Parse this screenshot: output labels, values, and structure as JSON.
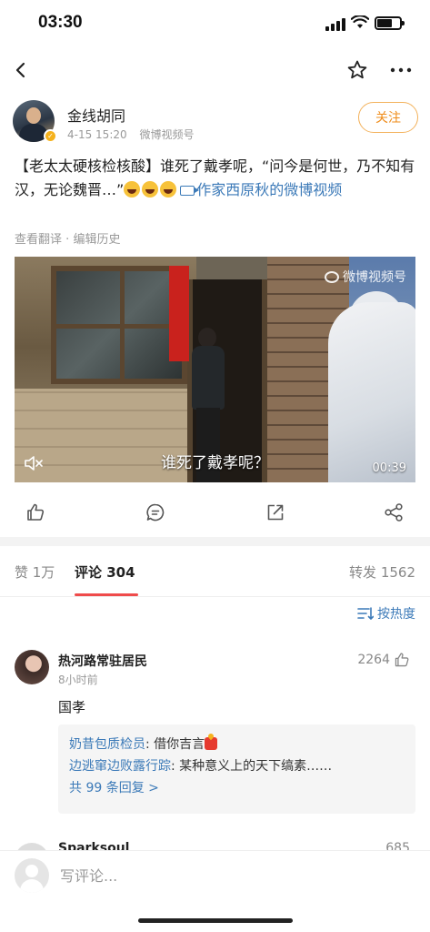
{
  "status_bar": {
    "time": "03:30"
  },
  "post": {
    "author": "金线胡同",
    "date": "4-15 15:20",
    "source": "微博视频号",
    "follow_label": "关注",
    "text_main": "【老太太硬核检核酸】谁死了戴孝呢，“问今是何世，乃不知有汉，无论魏晋…”",
    "text_link": "作家西原秋的微博视频",
    "translate_label": "查看翻译",
    "edit_history_label": "编辑历史",
    "separator": "·"
  },
  "video": {
    "watermark": "微博视频号",
    "subtitle": "谁死了戴孝呢？",
    "duration": "00:39"
  },
  "tabs": {
    "likes": "赞 1万",
    "comments": "评论 304",
    "reposts": "转发 1562"
  },
  "sort_label": "按热度",
  "comments": [
    {
      "user": "热河路常驻居民",
      "time": "8小时前",
      "likes": "2264",
      "text": "国孝",
      "replies": [
        {
          "user": "奶昔包质检员",
          "text": "借你吉言"
        },
        {
          "user": "边逃窜边败露行踪",
          "text": "某种意义上的天下缟素……"
        }
      ],
      "more_replies": "共 99 条回复 >"
    },
    {
      "user": "Sparksoul",
      "likes": "685"
    }
  ],
  "comment_input": {
    "placeholder": "写评论..."
  },
  "icons": {
    "back": "back-arrow-icon",
    "favorite": "star-icon",
    "more": "more-icon",
    "like": "thumb-up-icon",
    "comment": "comment-icon",
    "share": "share-icon",
    "repost": "repost-icon",
    "sort": "sort-icon"
  },
  "colors": {
    "accent_link": "#3c7ab8",
    "follow_orange": "#ef8c1a",
    "tab_underline": "#ef4b4b",
    "verified": "#f5b21d"
  }
}
